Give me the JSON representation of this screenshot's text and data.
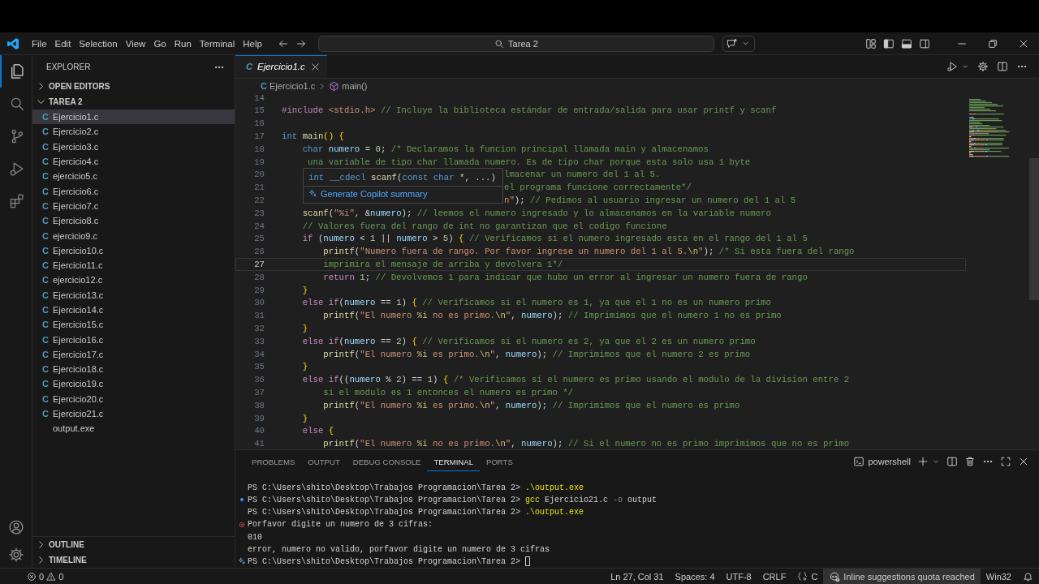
{
  "window": {
    "menu": [
      "File",
      "Edit",
      "Selection",
      "View",
      "Go",
      "Run",
      "Terminal",
      "Help"
    ],
    "search": {
      "value": "Tarea 2"
    }
  },
  "activity_bar": {
    "items": [
      {
        "selected": true
      },
      {
        "selected": false
      },
      {
        "selected": false
      },
      {
        "selected": false
      },
      {
        "selected": false
      }
    ]
  },
  "sidebar": {
    "title": "EXPLORER",
    "sections": [
      {
        "label": "OPEN EDITORS",
        "expanded": false
      },
      {
        "label": "TAREA 2",
        "expanded": true,
        "items": [
          {
            "icon": "C",
            "label": "Ejercicio1.c",
            "selected": true
          },
          {
            "icon": "C",
            "label": "Ejercicio2.c",
            "selected": false
          },
          {
            "icon": "C",
            "label": "Ejercicio3.c",
            "selected": false
          },
          {
            "icon": "C",
            "label": "Ejercicio4.c",
            "selected": false
          },
          {
            "icon": "C",
            "label": "ejercicio5.c",
            "selected": false
          },
          {
            "icon": "C",
            "label": "Ejercicio6.c",
            "selected": false
          },
          {
            "icon": "C",
            "label": "Ejercicio7.c",
            "selected": false
          },
          {
            "icon": "C",
            "label": "Ejercicio8.c",
            "selected": false
          },
          {
            "icon": "C",
            "label": "ejercicio9.c",
            "selected": false
          },
          {
            "icon": "C",
            "label": "Ejercicio10.c",
            "selected": false
          },
          {
            "icon": "C",
            "label": "Ejercicio11.c",
            "selected": false
          },
          {
            "icon": "C",
            "label": "ejercicio12.c",
            "selected": false
          },
          {
            "icon": "C",
            "label": "Ejercicio13.c",
            "selected": false
          },
          {
            "icon": "C",
            "label": "Ejercicio14.c",
            "selected": false
          },
          {
            "icon": "C",
            "label": "Ejercicio15.c",
            "selected": false
          },
          {
            "icon": "C",
            "label": "Ejercicio16.c",
            "selected": false
          },
          {
            "icon": "C",
            "label": "Ejercicio17.c",
            "selected": false
          },
          {
            "icon": "C",
            "label": "Ejercicio18.c",
            "selected": false
          },
          {
            "icon": "C",
            "label": "Ejercicio19.c",
            "selected": false
          },
          {
            "icon": "C",
            "label": "Ejercicio20.c",
            "selected": false
          },
          {
            "icon": "C",
            "label": "Ejercicio21.c",
            "selected": false
          },
          {
            "label": "output.exe",
            "selected": false
          }
        ]
      }
    ],
    "bottom_sections": [
      {
        "label": "OUTLINE",
        "expanded": false
      },
      {
        "label": "TIMELINE",
        "expanded": false
      }
    ]
  },
  "editor": {
    "tabs": [
      {
        "icon": "C",
        "label": "Ejercicio1.c",
        "selected": true,
        "preview": true
      }
    ],
    "breadcrumbs": {
      "icon": "C",
      "file": "Ejercicio1.c",
      "symbol": "main()"
    },
    "lines": [
      {
        "number": "14",
        "current": false
      },
      {
        "number": "15",
        "current": false,
        "segments": [
          {
            "kind": "preproc",
            "text": "#include "
          },
          {
            "kind": "string",
            "text": "<stdio.h> "
          },
          {
            "kind": "comment",
            "text": "// Incluye la biblioteca estándar de entrada/salida para usar printf y scanf"
          }
        ]
      },
      {
        "number": "16",
        "current": false
      },
      {
        "number": "17",
        "current": false,
        "segments": [
          {
            "kind": "keyword",
            "text": "int "
          },
          {
            "kind": "func",
            "text": "main"
          },
          {
            "kind": "bracket",
            "text": "() {"
          }
        ]
      },
      {
        "number": "18",
        "current": false,
        "segments": [
          {
            "kind": "keyword",
            "text": "    char "
          },
          {
            "kind": "var",
            "text": "numero"
          },
          {
            "kind": "plain",
            "text": " = "
          },
          {
            "kind": "number",
            "text": "0"
          },
          {
            "kind": "plain",
            "text": "; "
          },
          {
            "kind": "comment",
            "text": "/* Declaramos la funcion principal llamada main y almacenamos"
          }
        ]
      },
      {
        "number": "19",
        "current": false,
        "segments": [
          {
            "kind": "comment",
            "text": "     una variable de tipo char llamada numero. Es de tipo char porque esta solo usa 1 byte"
          }
        ]
      },
      {
        "number": "20",
        "current": false,
        "segments_beside_hover": [
          {
            "kind": "comment",
            "text": "lmacenar un numero del 1 al 5."
          }
        ]
      },
      {
        "number": "21",
        "current": false,
        "segments_beside_hover": [
          {
            "kind": "comment",
            "text": "el programa funcione correctamente*/"
          }
        ]
      },
      {
        "number": "22",
        "current": false,
        "segments_beside_hover": [
          {
            "kind": "string",
            "text": "n\""
          },
          {
            "kind": "plain",
            "text": "); "
          },
          {
            "kind": "comment",
            "text": "// Pedimos al usuario ingresar un numero del 1 al 5"
          }
        ]
      },
      {
        "number": "23",
        "current": false,
        "segments": [
          {
            "kind": "func",
            "text": "    scanf"
          },
          {
            "kind": "plain",
            "text": "("
          },
          {
            "kind": "string",
            "text": "\"%i\""
          },
          {
            "kind": "plain",
            "text": ", &"
          },
          {
            "kind": "var",
            "text": "numero"
          },
          {
            "kind": "plain",
            "text": "); "
          },
          {
            "kind": "comment",
            "text": "// leemos el numero ingresado y lo almacenamos en la variable numero"
          }
        ]
      },
      {
        "number": "24",
        "current": false,
        "segments": [
          {
            "kind": "comment",
            "text": "    // Valores fuera del rango de int no garantizan que el codigo funcione"
          }
        ]
      },
      {
        "number": "25",
        "current": false,
        "segments": [
          {
            "kind": "control",
            "text": "    if"
          },
          {
            "kind": "plain",
            "text": " ("
          },
          {
            "kind": "var",
            "text": "numero"
          },
          {
            "kind": "plain",
            "text": " < "
          },
          {
            "kind": "number",
            "text": "1"
          },
          {
            "kind": "plain",
            "text": " || "
          },
          {
            "kind": "var",
            "text": "numero"
          },
          {
            "kind": "plain",
            "text": " > "
          },
          {
            "kind": "number",
            "text": "5"
          },
          {
            "kind": "plain",
            "text": ") "
          },
          {
            "kind": "bracket",
            "text": "{ "
          },
          {
            "kind": "comment",
            "text": "// Verificamos si el numero ingresado esta en el rango del 1 al 5"
          }
        ]
      },
      {
        "number": "26",
        "current": false,
        "segments": [
          {
            "kind": "func",
            "text": "        printf"
          },
          {
            "kind": "plain",
            "text": "("
          },
          {
            "kind": "string",
            "text": "\"Numero fuera de rango. Por favor ingrese un numero del 1 al 5."
          },
          {
            "kind": "escape",
            "text": "\\n"
          },
          {
            "kind": "string",
            "text": "\""
          },
          {
            "kind": "plain",
            "text": "); "
          },
          {
            "kind": "comment",
            "text": "/* Si esta fuera del rango"
          }
        ]
      },
      {
        "number": "27",
        "current": true,
        "segments": [
          {
            "kind": "comment",
            "text": "        imprimira el mensaje de arriba y devolvera 1*/"
          }
        ]
      },
      {
        "number": "28",
        "current": false,
        "segments": [
          {
            "kind": "control",
            "text": "        return "
          },
          {
            "kind": "number",
            "text": "1"
          },
          {
            "kind": "plain",
            "text": "; "
          },
          {
            "kind": "comment",
            "text": "// Devolvemos 1 para indicar que hubo un error al ingresar un numero fuera de rango"
          }
        ]
      },
      {
        "number": "29",
        "current": false,
        "segments": [
          {
            "kind": "bracket",
            "text": "    }"
          }
        ]
      },
      {
        "number": "30",
        "current": false,
        "segments": [
          {
            "kind": "control",
            "text": "    else if"
          },
          {
            "kind": "plain",
            "text": "("
          },
          {
            "kind": "var",
            "text": "numero"
          },
          {
            "kind": "plain",
            "text": " == "
          },
          {
            "kind": "number",
            "text": "1"
          },
          {
            "kind": "plain",
            "text": ") "
          },
          {
            "kind": "bracket",
            "text": "{ "
          },
          {
            "kind": "comment",
            "text": "// Verificamos si el numero es 1, ya que el 1 no es un numero primo"
          }
        ]
      },
      {
        "number": "31",
        "current": false,
        "segments": [
          {
            "kind": "func",
            "text": "        printf"
          },
          {
            "kind": "plain",
            "text": "("
          },
          {
            "kind": "string",
            "text": "\"El numero "
          },
          {
            "kind": "escape",
            "text": "%i"
          },
          {
            "kind": "string",
            "text": " no es primo."
          },
          {
            "kind": "escape",
            "text": "\\n"
          },
          {
            "kind": "string",
            "text": "\""
          },
          {
            "kind": "plain",
            "text": ", "
          },
          {
            "kind": "var",
            "text": "numero"
          },
          {
            "kind": "plain",
            "text": "); "
          },
          {
            "kind": "comment",
            "text": "// Imprimimos que el numero 1 no es primo"
          }
        ]
      },
      {
        "number": "32",
        "current": false,
        "segments": [
          {
            "kind": "bracket",
            "text": "    }"
          }
        ]
      },
      {
        "number": "33",
        "current": false,
        "segments": [
          {
            "kind": "control",
            "text": "    else if"
          },
          {
            "kind": "plain",
            "text": "("
          },
          {
            "kind": "var",
            "text": "numero"
          },
          {
            "kind": "plain",
            "text": " == "
          },
          {
            "kind": "number",
            "text": "2"
          },
          {
            "kind": "plain",
            "text": ") "
          },
          {
            "kind": "bracket",
            "text": "{ "
          },
          {
            "kind": "comment",
            "text": "// Verificamos si el numero es 2, ya que el 2 es un numero primo"
          }
        ]
      },
      {
        "number": "34",
        "current": false,
        "segments": [
          {
            "kind": "func",
            "text": "        printf"
          },
          {
            "kind": "plain",
            "text": "("
          },
          {
            "kind": "string",
            "text": "\"El numero "
          },
          {
            "kind": "escape",
            "text": "%i"
          },
          {
            "kind": "string",
            "text": " es primo."
          },
          {
            "kind": "escape",
            "text": "\\n"
          },
          {
            "kind": "string",
            "text": "\""
          },
          {
            "kind": "plain",
            "text": ", "
          },
          {
            "kind": "var",
            "text": "numero"
          },
          {
            "kind": "plain",
            "text": "); "
          },
          {
            "kind": "comment",
            "text": "// Imprimimos que el numero 2 es primo"
          }
        ]
      },
      {
        "number": "35",
        "current": false,
        "segments": [
          {
            "kind": "bracket",
            "text": "    }"
          }
        ]
      },
      {
        "number": "36",
        "current": false,
        "segments": [
          {
            "kind": "control",
            "text": "    else if"
          },
          {
            "kind": "plain",
            "text": "(("
          },
          {
            "kind": "var",
            "text": "numero"
          },
          {
            "kind": "plain",
            "text": " % "
          },
          {
            "kind": "number",
            "text": "2"
          },
          {
            "kind": "plain",
            "text": ") == "
          },
          {
            "kind": "number",
            "text": "1"
          },
          {
            "kind": "plain",
            "text": ") "
          },
          {
            "kind": "bracket",
            "text": "{ "
          },
          {
            "kind": "comment",
            "text": "/* Verificamos si el numero es primo usando el modulo de la division entre 2"
          }
        ]
      },
      {
        "number": "37",
        "current": false,
        "segments": [
          {
            "kind": "comment",
            "text": "        si el modulo es 1 entonces el numero es primo */"
          }
        ]
      },
      {
        "number": "38",
        "current": false,
        "segments": [
          {
            "kind": "func",
            "text": "        printf"
          },
          {
            "kind": "plain",
            "text": "("
          },
          {
            "kind": "string",
            "text": "\"El numero "
          },
          {
            "kind": "escape",
            "text": "%i"
          },
          {
            "kind": "string",
            "text": " es primo."
          },
          {
            "kind": "escape",
            "text": "\\n"
          },
          {
            "kind": "string",
            "text": "\""
          },
          {
            "kind": "plain",
            "text": ", "
          },
          {
            "kind": "var",
            "text": "numero"
          },
          {
            "kind": "plain",
            "text": "); "
          },
          {
            "kind": "comment",
            "text": "// Imprimimos que el numero es primo"
          }
        ]
      },
      {
        "number": "39",
        "current": false,
        "segments": [
          {
            "kind": "bracket",
            "text": "    }"
          }
        ]
      },
      {
        "number": "40",
        "current": false,
        "segments": [
          {
            "kind": "control",
            "text": "    else "
          },
          {
            "kind": "bracket",
            "text": "{"
          }
        ]
      },
      {
        "number": "41",
        "current": false,
        "segments": [
          {
            "kind": "func",
            "text": "        printf"
          },
          {
            "kind": "plain",
            "text": "("
          },
          {
            "kind": "string",
            "text": "\"El numero "
          },
          {
            "kind": "escape",
            "text": "%i"
          },
          {
            "kind": "string",
            "text": " no es primo."
          },
          {
            "kind": "escape",
            "text": "\\n"
          },
          {
            "kind": "string",
            "text": "\""
          },
          {
            "kind": "plain",
            "text": ", "
          },
          {
            "kind": "var",
            "text": "numero"
          },
          {
            "kind": "plain",
            "text": "); "
          },
          {
            "kind": "comment",
            "text": "// Si el numero no es primo imprimimos que no es primo"
          }
        ]
      }
    ],
    "hover": {
      "signature": [
        {
          "kind": "keyword",
          "text": "int __cdecl "
        },
        {
          "kind": "func",
          "text": "scanf"
        },
        {
          "kind": "plain",
          "text": "("
        },
        {
          "kind": "keyword",
          "text": "const char "
        },
        {
          "kind": "plain",
          "text": "*, ...)"
        }
      ],
      "action": "Generate Copilot summary"
    }
  },
  "panel": {
    "tabs": [
      {
        "label": "PROBLEMS",
        "selected": false
      },
      {
        "label": "OUTPUT",
        "selected": false
      },
      {
        "label": "DEBUG CONSOLE",
        "selected": false
      },
      {
        "label": "TERMINAL",
        "selected": true
      },
      {
        "label": "PORTS",
        "selected": false
      }
    ],
    "terminal_name": "powershell",
    "lines": [
      {
        "kind": "plain",
        "segments": [
          {
            "kind": "plain",
            "text": "PS C:\\Users\\shito\\Desktop\\Trabajos Programacion\\Tarea 2> "
          },
          {
            "kind": "command",
            "text": ".\\output.exe"
          }
        ]
      },
      {
        "kind": "success",
        "segments": [
          {
            "kind": "plain",
            "text": "PS C:\\Users\\shito\\Desktop\\Trabajos Programacion\\Tarea 2> "
          },
          {
            "kind": "command",
            "text": "gcc"
          },
          {
            "kind": "plain",
            "text": " Ejercicio21.c "
          },
          {
            "kind": "flag",
            "text": "-o"
          },
          {
            "kind": "plain",
            "text": " output"
          }
        ]
      },
      {
        "kind": "plain",
        "segments": [
          {
            "kind": "plain",
            "text": "PS C:\\Users\\shito\\Desktop\\Trabajos Programacion\\Tarea 2> "
          },
          {
            "kind": "command",
            "text": ".\\output.exe"
          }
        ]
      },
      {
        "kind": "error",
        "segments": [
          {
            "kind": "plain",
            "text": "Porfavor digite un numero de 3 cifras:"
          }
        ]
      },
      {
        "kind": "plain",
        "segments": [
          {
            "kind": "plain",
            "text": "010"
          }
        ]
      },
      {
        "kind": "plain",
        "segments": [
          {
            "kind": "plain",
            "text": "error, numero no valido, porfavor digite un numero de 3 cifras"
          }
        ]
      },
      {
        "kind": "hint",
        "cursor": true,
        "segments": [
          {
            "kind": "plain",
            "text": "PS C:\\Users\\shito\\Desktop\\Trabajos Programacion\\Tarea 2> "
          }
        ]
      }
    ]
  },
  "status_bar": {
    "errors": "0",
    "warnings": "0",
    "items": [
      {
        "kind": "text",
        "text": "Ln 27, Col 31"
      },
      {
        "kind": "text",
        "text": "Spaces: 4"
      },
      {
        "kind": "text",
        "text": "UTF-8"
      },
      {
        "kind": "text",
        "text": "CRLF"
      },
      {
        "kind": "language",
        "text": "C"
      },
      {
        "kind": "copilot",
        "text": "Inline suggestions quota reached"
      },
      {
        "kind": "text",
        "text": "Win32"
      },
      {
        "kind": "bell"
      }
    ]
  }
}
